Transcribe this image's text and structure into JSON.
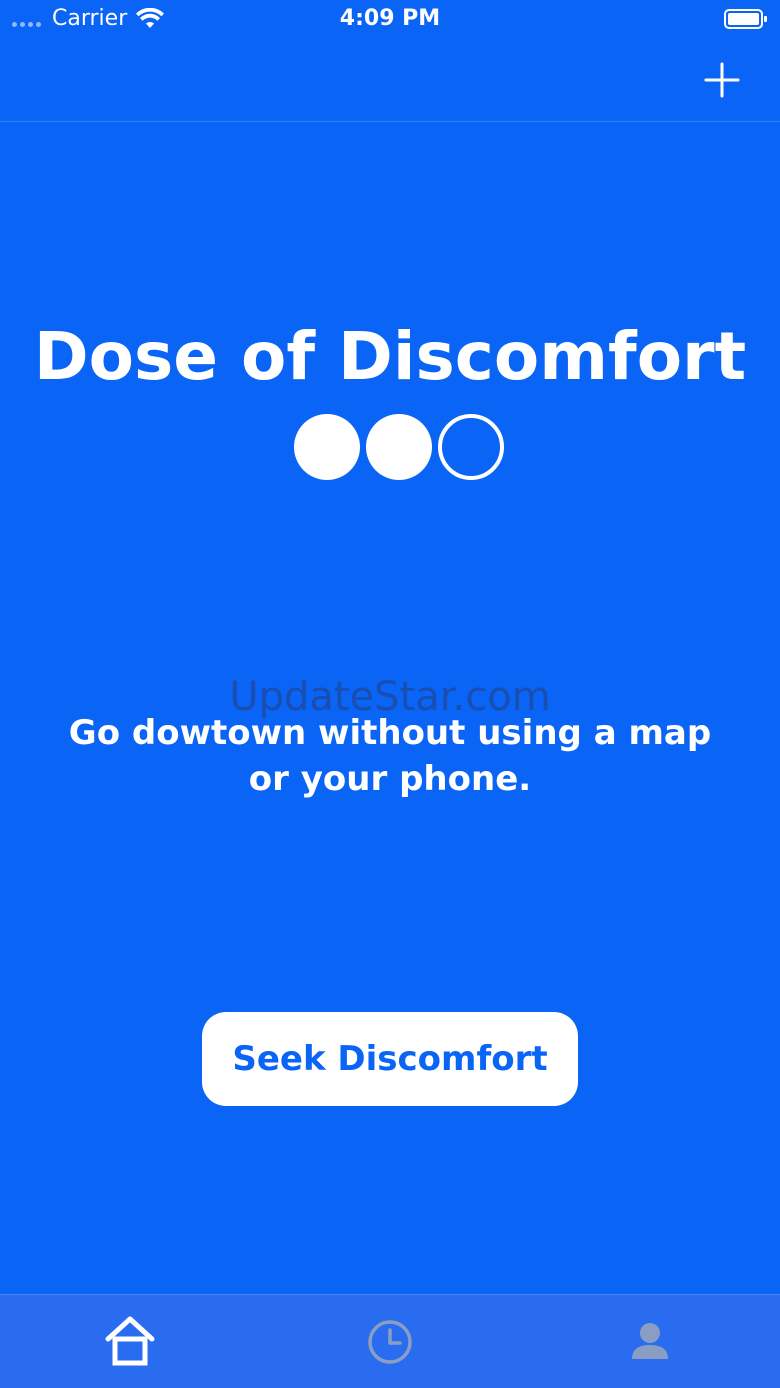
{
  "status_bar": {
    "carrier": "Carrier",
    "time": "4:09 PM"
  },
  "nav": {
    "add_icon": "plus-icon"
  },
  "main": {
    "title": "Dose of Discomfort",
    "dose_level": 2,
    "dose_max": 3,
    "watermark": "UpdateStar.com",
    "challenge_text": "Go dowtown without using a map or your phone.",
    "seek_button_label": "Seek Discomfort"
  },
  "tab_bar": {
    "tabs": [
      {
        "icon": "home-icon",
        "active": true
      },
      {
        "icon": "clock-icon",
        "active": false
      },
      {
        "icon": "person-icon",
        "active": false
      }
    ]
  },
  "colors": {
    "background": "#0a64f5",
    "tab_bar": "#2a6cf0",
    "accent_text": "#0a64f5",
    "inactive_icon": "#8a9ec4"
  }
}
